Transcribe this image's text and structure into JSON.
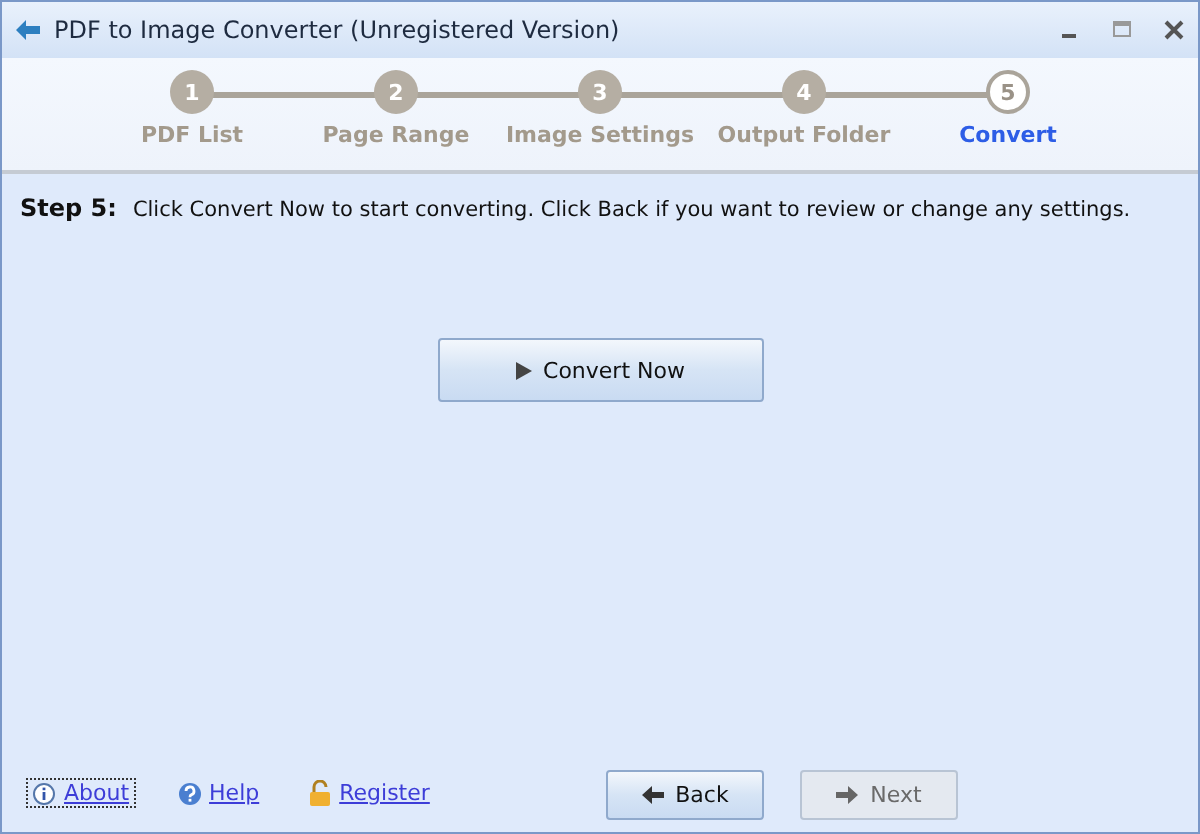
{
  "window": {
    "title": "PDF to Image Converter (Unregistered Version)"
  },
  "steps": [
    {
      "number": "1",
      "label": "PDF List",
      "selected": false
    },
    {
      "number": "2",
      "label": "Page Range",
      "selected": false
    },
    {
      "number": "3",
      "label": "Image Settings",
      "selected": false
    },
    {
      "number": "4",
      "label": "Output Folder",
      "selected": false
    },
    {
      "number": "5",
      "label": "Convert",
      "selected": true
    }
  ],
  "instruction": {
    "step": "Step 5:",
    "text": "Click Convert Now to start converting. Click Back if you want to review or change any settings."
  },
  "convert_button": {
    "label": "Convert Now"
  },
  "links": [
    {
      "kind": "about",
      "label": "About"
    },
    {
      "kind": "help",
      "label": "Help"
    },
    {
      "kind": "register",
      "label": "Register"
    }
  ],
  "nav_buttons": [
    {
      "kind": "back",
      "label": "Back",
      "disabled": false
    },
    {
      "kind": "next",
      "label": "Next",
      "disabled": true
    }
  ]
}
